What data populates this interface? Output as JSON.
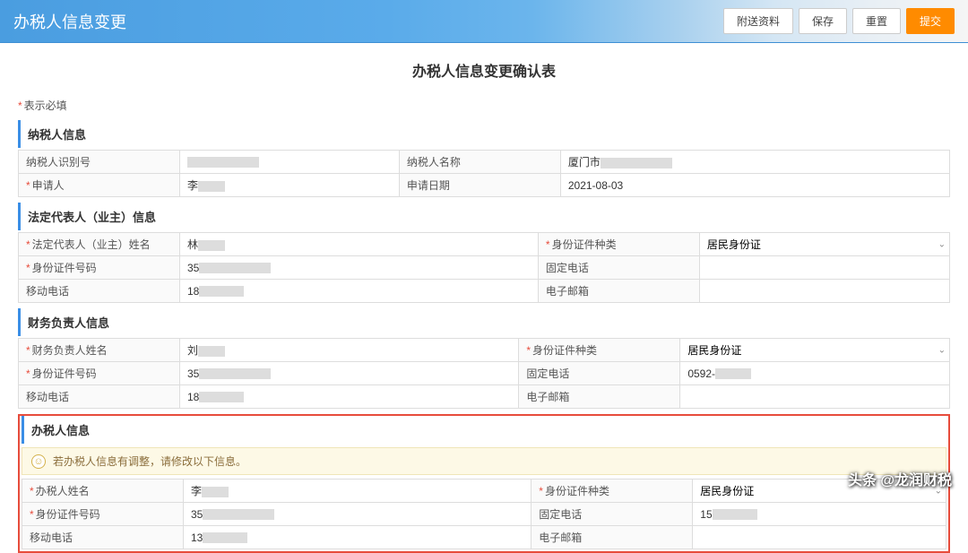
{
  "header": {
    "title": "办税人信息变更",
    "buttons": {
      "attachment": "附送资料",
      "save": "保存",
      "reset": "重置",
      "submit": "提交"
    }
  },
  "page_subtitle": "办税人信息变更确认表",
  "required_note_prefix": "*",
  "required_note_text": "表示必填",
  "sections": {
    "taxpayer": {
      "title": "纳税人信息",
      "fields": {
        "id_label": "纳税人识别号",
        "name_label": "纳税人名称",
        "name_value_prefix": "厦门市",
        "applicant_label": "申请人",
        "applicant_value_prefix": "李",
        "apply_date_label": "申请日期",
        "apply_date_value": "2021-08-03"
      }
    },
    "legal_rep": {
      "title": "法定代表人（业主）信息",
      "fields": {
        "name_label": "法定代表人（业主）姓名",
        "name_value_prefix": "林",
        "id_type_label": "身份证件种类",
        "id_type_value": "居民身份证",
        "id_number_label": "身份证件号码",
        "id_number_value_prefix": "35",
        "fixed_phone_label": "固定电话",
        "mobile_label": "移动电话",
        "mobile_value_prefix": "18",
        "email_label": "电子邮箱"
      }
    },
    "finance_head": {
      "title": "财务负责人信息",
      "fields": {
        "name_label": "财务负责人姓名",
        "name_value_prefix": "刘",
        "id_type_label": "身份证件种类",
        "id_type_value": "居民身份证",
        "id_number_label": "身份证件号码",
        "id_number_value_prefix": "35",
        "fixed_phone_label": "固定电话",
        "fixed_phone_value_prefix": "0592-",
        "mobile_label": "移动电话",
        "mobile_value_prefix": "18",
        "email_label": "电子邮箱"
      }
    },
    "tax_agent": {
      "title": "办税人信息",
      "banner": "若办税人信息有调整，请修改以下信息。",
      "fields": {
        "name_label": "办税人姓名",
        "name_value_prefix": "李",
        "id_type_label": "身份证件种类",
        "id_type_value": "居民身份证",
        "id_number_label": "身份证件号码",
        "id_number_value_prefix": "35",
        "fixed_phone_label": "固定电话",
        "fixed_phone_value_prefix": "15",
        "mobile_label": "移动电话",
        "mobile_value_prefix": "13",
        "email_label": "电子邮箱"
      }
    }
  },
  "watermark": "头条 @龙润财税"
}
